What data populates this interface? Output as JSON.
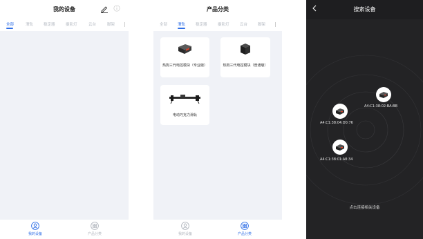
{
  "my_devices": {
    "title": "我的设备",
    "tabs": [
      {
        "label": "全部",
        "active": true
      },
      {
        "label": "滑轨",
        "active": false
      },
      {
        "label": "稳定器",
        "active": false
      },
      {
        "label": "摄影灯",
        "active": false
      },
      {
        "label": "云台",
        "active": false
      },
      {
        "label": "脚架",
        "active": false
      }
    ],
    "nav": [
      {
        "label": "我的设备",
        "active": true,
        "icon": "user-icon"
      },
      {
        "label": "产品分类",
        "active": false,
        "icon": "grid-icon"
      }
    ]
  },
  "product_category": {
    "title": "产品分类",
    "tabs": [
      {
        "label": "全部",
        "active": false
      },
      {
        "label": "滑轨",
        "active": true
      },
      {
        "label": "稳定器",
        "active": false
      },
      {
        "label": "摄影灯",
        "active": false
      },
      {
        "label": "云台",
        "active": false
      },
      {
        "label": "脚架",
        "active": false
      }
    ],
    "products": [
      {
        "name": "热狗三代电控模块（专业版）"
      },
      {
        "name": "热狗三代电控模块（普通版）"
      },
      {
        "name": "电动巧克力滑轨"
      }
    ],
    "nav": [
      {
        "label": "我的设备",
        "active": false,
        "icon": "user-icon"
      },
      {
        "label": "产品分类",
        "active": true,
        "icon": "grid-icon"
      }
    ]
  },
  "search": {
    "title": "搜索设备",
    "devices": [
      {
        "mac": "A4:C1:38:02:BA:BB"
      },
      {
        "mac": "A4:C1:38:04:D0:76"
      },
      {
        "mac": "A4:C1:38:01:A8:34"
      }
    ],
    "hint": "点击连接相关设备"
  },
  "colors": {
    "accent": "#2f6ee6",
    "content_bg": "#f0f2f7",
    "dark_bg": "#1e1e20"
  }
}
